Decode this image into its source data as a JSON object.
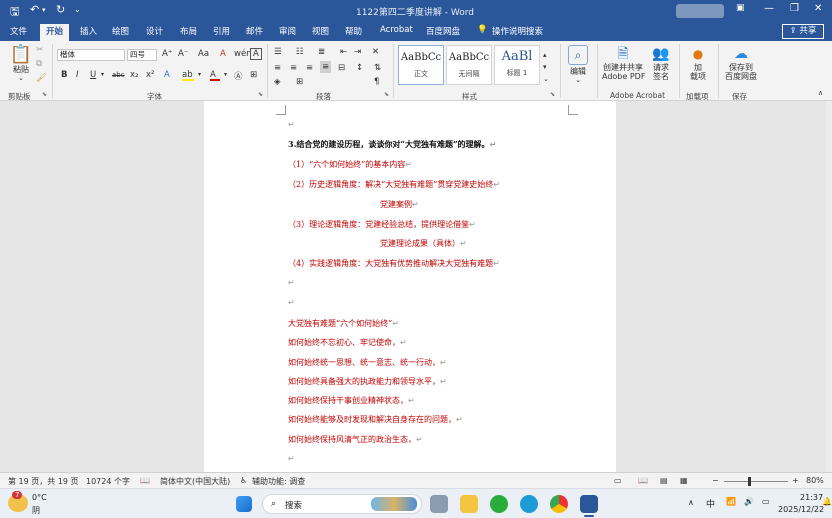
{
  "titlebar": {
    "title": "1122第四二季度讲解 - Word",
    "minimize": "—",
    "restore": "❐",
    "close": "✕"
  },
  "menu": {
    "tabs": [
      "文件",
      "开始",
      "插入",
      "绘图",
      "设计",
      "布局",
      "引用",
      "邮件",
      "审阅",
      "视图",
      "帮助",
      "Acrobat",
      "百度网盘"
    ],
    "active": "开始",
    "tell_me": "操作说明搜索",
    "share": "共享"
  },
  "ribbon": {
    "clipboard": {
      "paste": "粘贴",
      "label": "剪贴板"
    },
    "font": {
      "name": "楷体",
      "size": "四号",
      "label": "字体",
      "bold": "B",
      "italic": "I",
      "underline": "U",
      "strike": "abc",
      "sub": "x₂",
      "sup": "x²",
      "grow": "A⁺",
      "shrink": "A⁻",
      "case": "Aa",
      "clear": "A",
      "wen": "wén",
      "box": "A",
      "color_a": "A",
      "hl": "ab"
    },
    "paragraph": {
      "label": "段落"
    },
    "styles": {
      "label": "样式",
      "items": [
        {
          "preview": "AaBbCc",
          "name": "正文"
        },
        {
          "preview": "AaBbCc",
          "name": "无间隔"
        },
        {
          "preview": "AaBl",
          "name": "标题 1"
        }
      ]
    },
    "editing": {
      "label": "编辑"
    },
    "acrobat": {
      "create": "创建并共享",
      "create2": "Adobe PDF",
      "sign": "请求",
      "sign2": "签名",
      "label": "Adobe Acrobat"
    },
    "addins": {
      "btn": "加",
      "btn2": "载项",
      "label": "加载项"
    },
    "save": {
      "btn": "保存到",
      "btn2": "百度网盘",
      "label": "保存"
    }
  },
  "document": {
    "lines": [
      {
        "text": "",
        "mark": "↵",
        "color": "blk"
      },
      {
        "text": "3.结合党的建设历程，谈谈你对“大党独有难题”的理解。",
        "mark": "↵",
        "color": "blk",
        "bold": true
      },
      {
        "text": "（1）“六个如何始终”的基本内容",
        "mark": "↵",
        "color": "red"
      },
      {
        "text": "（2）历史逻辑角度：解决“大党独有难题”贯穿党建史始终",
        "mark": "↵",
        "color": "red"
      },
      {
        "text": "党建案例",
        "mark": "↵",
        "color": "red",
        "indent": true
      },
      {
        "text": "（3）理论逻辑角度：党建经验总结，提供理论借鉴",
        "mark": "↵",
        "color": "red"
      },
      {
        "text": "党建理论成果（具体）",
        "mark": "↵",
        "color": "red",
        "indent": true
      },
      {
        "text": "（4）实践逻辑角度：大党独有优势推动解决大党独有难题",
        "mark": "↵",
        "color": "red"
      },
      {
        "text": "",
        "mark": "↵",
        "color": "blk"
      },
      {
        "text": "",
        "mark": "↵",
        "color": "blk"
      },
      {
        "text": "大党独有难题“六个如何始终”",
        "mark": "↵",
        "color": "red"
      },
      {
        "text": "如何始终不忘初心、牢记使命，",
        "mark": "↵",
        "color": "red"
      },
      {
        "text": "如何始终统一思想、统一意志、统一行动，",
        "mark": "↵",
        "color": "red"
      },
      {
        "text": "如何始终具备强大的执政能力和领导水平，",
        "mark": "↵",
        "color": "red"
      },
      {
        "text": "如何始终保持干事创业精神状态，",
        "mark": "↵",
        "color": "red"
      },
      {
        "text": "如何始终能够及时发现和解决自身存在的问题，",
        "mark": "↵",
        "color": "red"
      },
      {
        "text": "如何始终保持风清气正的政治生态，",
        "mark": "↵",
        "color": "red"
      },
      {
        "text": "",
        "mark": "↵",
        "color": "blk"
      }
    ]
  },
  "status": {
    "page": "第 19 页，共 19 页",
    "words": "10724 个字",
    "lang": "简体中文(中国大陆)",
    "access": "辅助功能: 调查",
    "zoom": "80%"
  },
  "taskbar": {
    "weather_temp": "0°C",
    "weather_desc": "阴",
    "weather_badge": "7",
    "search": "搜索",
    "ime": "中",
    "time": "21:37",
    "date": "2025/12/22"
  }
}
